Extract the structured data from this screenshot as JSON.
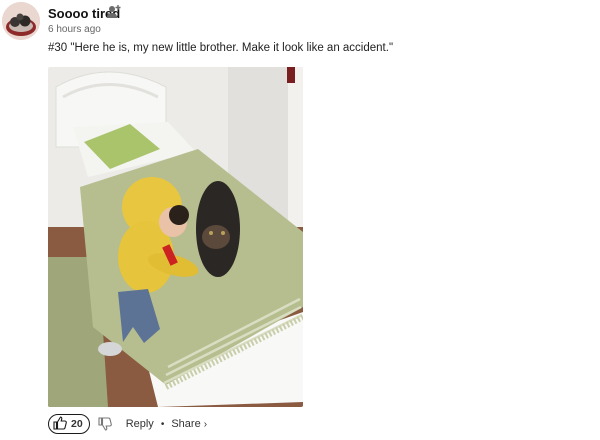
{
  "post": {
    "username": "Soooo tired",
    "time": "6 hours ago",
    "text": "#30 \"Here he is, my new little brother. Make it look like an accident.\""
  },
  "actions": {
    "upvote_count": "20",
    "reply_label": "Reply",
    "separator": "•",
    "share_label": "Share",
    "share_chevron": "›"
  },
  "icons": {
    "follow": "add-user-icon",
    "upvote": "thumbs-up-icon",
    "downvote": "thumbs-down-icon"
  }
}
